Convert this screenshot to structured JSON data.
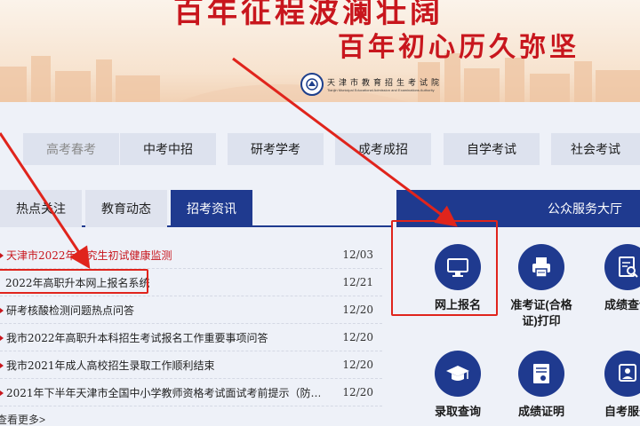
{
  "banner": {
    "slogan_top": "百年征程波澜壮阔",
    "slogan_bottom": "百年初心历久弥坚",
    "logo_cn": "天津市教育招生考试院",
    "logo_en": "Tianjin Municipal Educational Admission and Examinations Authority"
  },
  "nav": [
    {
      "label": "高考春考"
    },
    {
      "label": "中考中招"
    },
    {
      "label": "研考学考"
    },
    {
      "label": "成考成招"
    },
    {
      "label": "自学考试"
    },
    {
      "label": "社会考试"
    }
  ],
  "tabs": [
    {
      "label": "热点关注"
    },
    {
      "label": "教育动态"
    },
    {
      "label": "招考资讯"
    }
  ],
  "news": [
    {
      "title": "天津市2022年研究生初试健康监测",
      "date": "12/03"
    },
    {
      "title": "2022年高职升本网上报名系统",
      "date": "12/21"
    },
    {
      "title": "研考核酸检测问题热点问答",
      "date": "12/20"
    },
    {
      "title": "我市2022年高职升本科招生考试报名工作重要事项问答",
      "date": "12/20"
    },
    {
      "title": "我市2021年成人高校招生录取工作顺利结束",
      "date": "12/20"
    },
    {
      "title": "2021年下半年天津市全国中小学教师资格考试面试考前提示（防…",
      "date": "12/20"
    }
  ],
  "more_label": "查看更多>",
  "services": {
    "header": "公众服务大厅",
    "items": [
      {
        "label": "网上报名",
        "icon": "monitor-icon"
      },
      {
        "label": "准考证(合格证)打印",
        "icon": "printer-icon"
      },
      {
        "label": "成绩查询",
        "icon": "search-doc-icon"
      },
      {
        "label": "录取查询",
        "icon": "graduation-cap-icon"
      },
      {
        "label": "成绩证明",
        "icon": "certificate-icon"
      },
      {
        "label": "自考服务",
        "icon": "service-icon"
      }
    ]
  },
  "colors": {
    "brand_blue": "#1f3a8f",
    "accent_red": "#c8161d",
    "annotation_red": "#e0241c"
  }
}
